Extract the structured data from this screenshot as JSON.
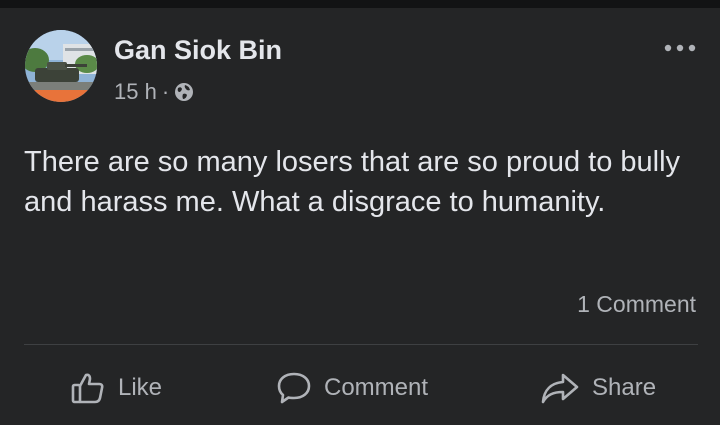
{
  "post": {
    "author": "Gan Siok Bin",
    "timestamp": "15 h",
    "separator": "·",
    "audience_icon": "globe-icon",
    "body": "There are so many losers that are so proud to bully and harass me. What a disgrace to humanity.",
    "comment_count": "1 Comment"
  },
  "actions": {
    "like_label": "Like",
    "comment_label": "Comment",
    "share_label": "Share"
  },
  "colors": {
    "background": "#242526",
    "primary_text": "#e4e6eb",
    "secondary_text": "#b0b3b8",
    "divider": "#3e4042"
  }
}
